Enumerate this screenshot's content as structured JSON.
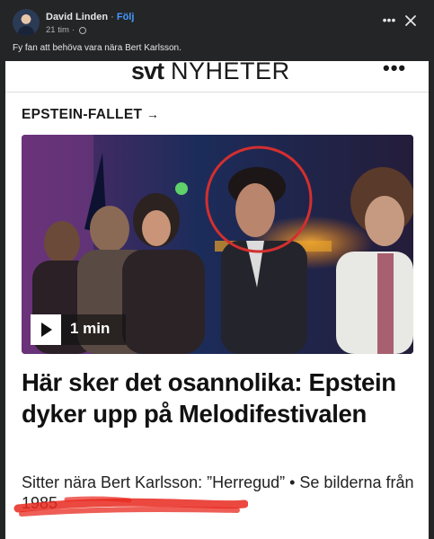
{
  "post": {
    "author": "David Linden",
    "separator": "·",
    "follow_label": "Följ",
    "time": "21 tim",
    "time_dot": "·",
    "caption": "Fy fan att behöva vara nära Bert Karlsson.",
    "more_label": "•••"
  },
  "article": {
    "site_logo_bold": "svt",
    "site_logo_rest": "NYHETER",
    "menu_label": "•••",
    "kicker": "EPSTEIN-FALLET",
    "kicker_arrow": "→",
    "video_duration": "1 min",
    "headline": "Här sker det osannolika: Epstein dyker upp på Melodifestivalen",
    "subhead": "Sitter nära Bert Karlsson: ”Herregud” • Se bilderna från 1985"
  },
  "colors": {
    "background": "#242526",
    "follow": "#4599ff",
    "highlight_circle": "#d32f2f",
    "scribble": "#e8281e"
  },
  "icons": [
    "avatar",
    "globe-icon",
    "more-icon",
    "close-icon",
    "arrow-right-icon",
    "play-icon"
  ]
}
